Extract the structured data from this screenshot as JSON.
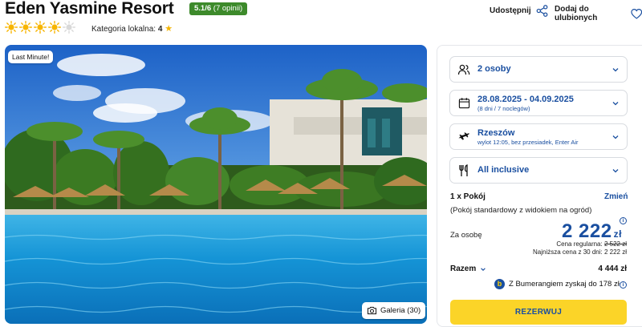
{
  "hotel": {
    "name": "Eden Yasmine Resort",
    "rating": "5.1/6",
    "opinions": "(7 opinii)",
    "sun_count": 4,
    "sun_total": 5,
    "local_category_label": "Kategoria lokalna:",
    "local_category_value": "4"
  },
  "actions": {
    "share_label": "Udostępnij",
    "favorite_label": "Dodaj do ulubionych"
  },
  "gallery": {
    "badge": "Last Minute!",
    "gallery_label": "Galeria (30)"
  },
  "booking": {
    "guests": "2 osoby",
    "dates": "28.08.2025 - 04.09.2025",
    "dates_sub": "(8 dni / 7 noclegów)",
    "departure": "Rzeszów",
    "departure_sub": "wylot 12:05, bez przesiadek, Enter Air",
    "board": "All inclusive",
    "room_count": "1 x Pokój",
    "change_label": "Zmień",
    "room_desc": "(Pokój standardowy z widokiem na ogród)",
    "per_person_label": "Za osobę",
    "price": "2 222",
    "currency": "zł",
    "regular_label": "Cena regularna:",
    "regular_price": "2 522 zł",
    "lowest_label": "Najniższa cena z 30 dni:",
    "lowest_price": "2 222 zł",
    "total_label": "Razem",
    "total_value": "4 444 zł",
    "bumerang_text": "Z Bumerangiem zyskaj do 178 zł",
    "reserve_label": "REZERWUJ"
  },
  "colors": {
    "brand_blue": "#1a4fa0",
    "rating_green": "#3d8a2b",
    "cta_yellow": "#fbd428",
    "sun_active": "#f7b500",
    "sun_inactive": "#d9d9d9"
  },
  "icons": [
    "sun-icon",
    "star-icon",
    "share-icon",
    "heart-icon",
    "camera-icon",
    "users-icon",
    "calendar-icon",
    "plane-icon",
    "cutlery-icon",
    "chevron-down-icon",
    "info-icon",
    "bumerang-logo-icon"
  ]
}
